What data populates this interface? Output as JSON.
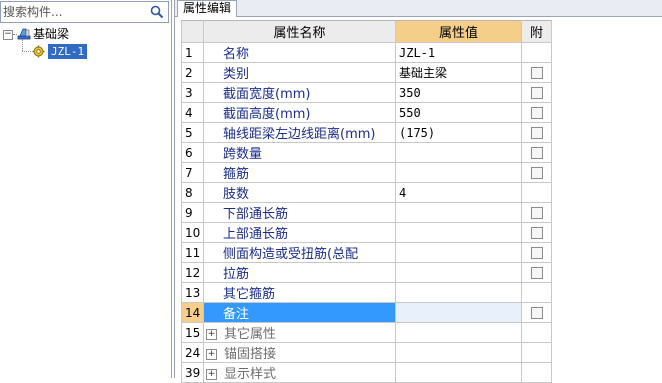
{
  "search": {
    "placeholder": "搜索构件..."
  },
  "tree": {
    "root_label": "基础梁",
    "child_label": "JZL-1"
  },
  "panel": {
    "tab_label": "属性编辑"
  },
  "grid": {
    "headers": {
      "name": "属性名称",
      "value": "属性值",
      "extra": "附"
    },
    "rows": [
      {
        "num": "1",
        "name": "名称",
        "value": "JZL-1",
        "checkbox": false
      },
      {
        "num": "2",
        "name": "类别",
        "value": "基础主梁",
        "checkbox": true
      },
      {
        "num": "3",
        "name": "截面宽度(mm)",
        "value": "350",
        "checkbox": true
      },
      {
        "num": "4",
        "name": "截面高度(mm)",
        "value": "550",
        "checkbox": true
      },
      {
        "num": "5",
        "name": "轴线距梁左边线距离(mm)",
        "value": "(175)",
        "checkbox": true
      },
      {
        "num": "6",
        "name": "跨数量",
        "value": "",
        "checkbox": true
      },
      {
        "num": "7",
        "name": "箍筋",
        "value": "",
        "checkbox": true
      },
      {
        "num": "8",
        "name": "肢数",
        "value": "4",
        "checkbox": false
      },
      {
        "num": "9",
        "name": "下部通长筋",
        "value": "",
        "checkbox": true
      },
      {
        "num": "10",
        "name": "上部通长筋",
        "value": "",
        "checkbox": true
      },
      {
        "num": "11",
        "name": "侧面构造或受扭筋(总配",
        "value": "",
        "checkbox": true
      },
      {
        "num": "12",
        "name": "拉筋",
        "value": "",
        "checkbox": true
      },
      {
        "num": "13",
        "name": "其它箍筋",
        "value": "",
        "checkbox": false
      },
      {
        "num": "14",
        "name": "备注",
        "value": "",
        "checkbox": true
      },
      {
        "num": "15",
        "name": "其它属性",
        "value": "",
        "checkbox": false
      },
      {
        "num": "24",
        "name": "锚固搭接",
        "value": "",
        "checkbox": false
      },
      {
        "num": "39",
        "name": "显示样式",
        "value": "",
        "checkbox": false
      }
    ],
    "selected_row": "14",
    "group_expander_symbol": "+"
  },
  "colors": {
    "header_value_bg": "#f5cf8a",
    "selected_name_bg": "#3399ff",
    "name_text": "#1a2d8c",
    "tree_selected_bg": "#316ac5"
  },
  "icons": {
    "search": "search-icon",
    "root": "beam-component-icon",
    "child": "gear-icon",
    "expander": "collapse-minus-icon"
  }
}
